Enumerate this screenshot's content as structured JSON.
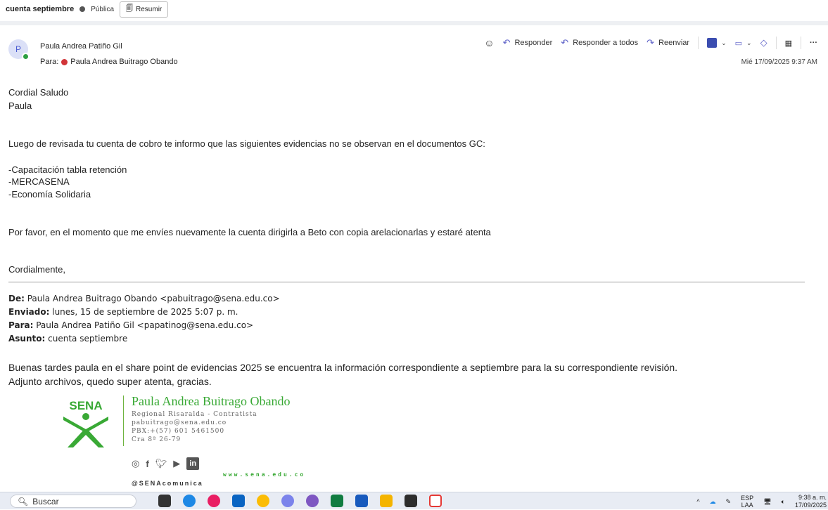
{
  "topbar": {
    "subject": "cuenta septiembre",
    "visibility": "Pública",
    "summarize_label": "Resumir"
  },
  "header": {
    "avatar_initial": "P",
    "sender_name": "Paula Andrea Patiño Gil",
    "to_label": "Para:",
    "to_name": "Paula Andrea Buitrago Obando",
    "date": "Mié 17/09/2025 9:37 AM",
    "actions": {
      "reply": "Responder",
      "reply_all": "Responder a todos",
      "forward": "Reenviar"
    }
  },
  "body": {
    "greeting": "Cordial Saludo",
    "greeting_name": "Paula",
    "line1": "Luego de revisada tu cuenta de cobro te informo que las siguientes evidencias no se observan en el documentos GC:",
    "items": [
      "-Capacitación tabla retención",
      "-MERCASENA",
      "-Economía Solidaria"
    ],
    "line2": "Por favor, en el momento que me envíes nuevamente la cuenta dirigirla a Beto con copia arelacionarlas y estaré atenta",
    "closing": "Cordialmente,"
  },
  "quoted": {
    "from_label": "De:",
    "from_value": "Paula Andrea Buitrago Obando <pabuitrago@sena.edu.co>",
    "sent_label": "Enviado:",
    "sent_value": "lunes, 15 de septiembre de 2025 5:07 p. m.",
    "to_label": "Para:",
    "to_value": "Paula Andrea Patiño Gil <papatinog@sena.edu.co>",
    "subject_label": "Asunto:",
    "subject_value": "cuenta septiembre",
    "text1": "Buenas tardes paula en el share point  de evidencias 2025 se encuentra la información correspondiente a septiembre para la su correspondiente revisión.",
    "text2": "Adjunto archivos, quedo super atenta, gracias."
  },
  "signature": {
    "logo_text": "SENA",
    "name": "Paula Andrea Buitrago Obando",
    "role": "Regional Risaralda - Contratista",
    "email": "pabuitrago@sena.edu.co",
    "phone": "PBX:+(57) 601 5461500",
    "address": "Cra 8ª 26-79",
    "website": "www.sena.edu.co",
    "handle": "@SENAcomunica",
    "linkedin": "in"
  },
  "taskbar": {
    "search_placeholder": "Buscar",
    "lang_top": "ESP",
    "lang_bottom": "LAA",
    "time": "9:38 a. m.",
    "date": "17/09/2025"
  }
}
